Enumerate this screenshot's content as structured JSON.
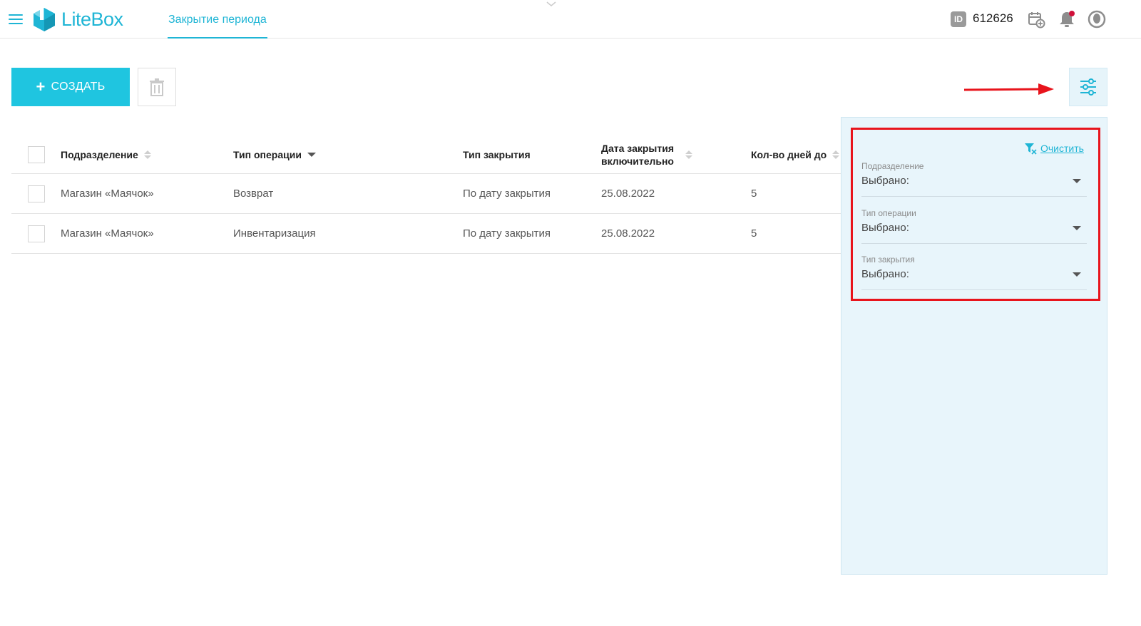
{
  "header": {
    "logo_text": "LiteBox",
    "active_tab": "Закрытие периода",
    "id_badge": "ID",
    "account_id": "612626",
    "brand_color": "#1fb5d5",
    "notification_dot_color": "#d0103a"
  },
  "toolbar": {
    "create_plus": "+",
    "create_label": "СОЗДАТЬ",
    "accent_color": "#1fc5e0"
  },
  "table": {
    "columns": [
      {
        "label": "Подразделение",
        "sort": "both"
      },
      {
        "label": "Тип операции",
        "sort": "desc"
      },
      {
        "label": "Тип закрытия",
        "sort": "none"
      },
      {
        "label": "Дата закрытия включительно",
        "sort": "both"
      },
      {
        "label": "Кол-во дней до",
        "sort": "both"
      }
    ],
    "rows": [
      {
        "division": "Магазин «Маячок»",
        "operation": "Возврат",
        "closing_type": "По дату закрытия",
        "closing_date": "25.08.2022",
        "days": "5"
      },
      {
        "division": "Магазин «Маячок»",
        "operation": "Инвентаризация",
        "closing_type": "По дату закрытия",
        "closing_date": "25.08.2022",
        "days": "5"
      }
    ]
  },
  "filters": {
    "clear_label": "Очистить",
    "fields": [
      {
        "label": "Подразделение",
        "value": "Выбрано:"
      },
      {
        "label": "Тип операции",
        "value": "Выбрано:"
      },
      {
        "label": "Тип закрытия",
        "value": "Выбрано:"
      }
    ],
    "highlight_color": "#e8141c"
  }
}
